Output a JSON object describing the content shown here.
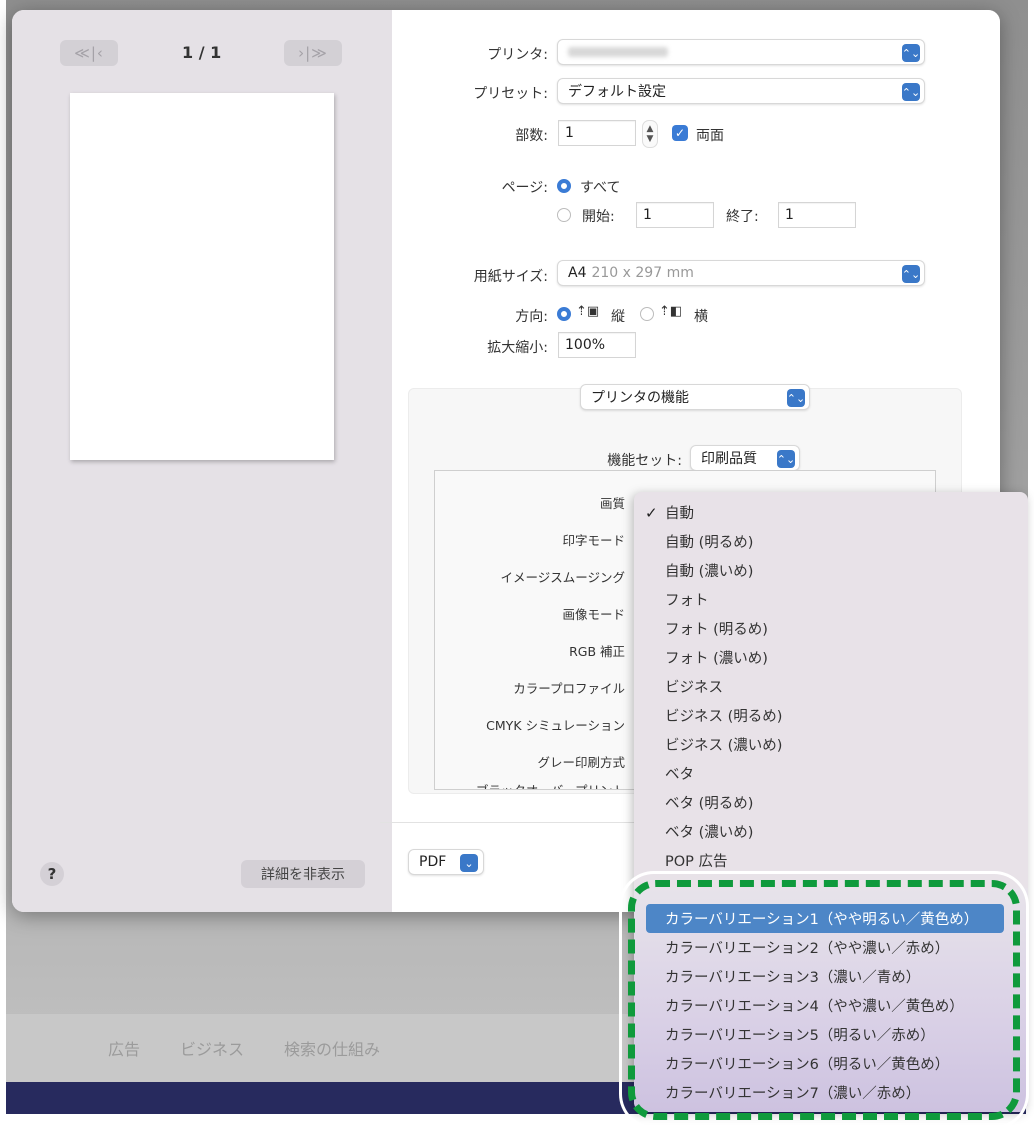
{
  "background_page": {
    "footer_links": [
      "広告",
      "ビジネス",
      "検索の仕組み"
    ],
    "colors": {
      "footer_bar": "#272a5e"
    }
  },
  "print_dialog": {
    "preview": {
      "first_prev_label": "≪|‹",
      "next_last_label": "›|≫",
      "page_indicator": "1 / 1"
    },
    "help_button_label": "?",
    "hide_details_label": "詳細を非表示",
    "printer": {
      "label": "プリンタ:",
      "value": "(blurred)"
    },
    "preset": {
      "label": "プリセット:",
      "value": "デフォルト設定"
    },
    "copies": {
      "label": "部数:",
      "value": "1",
      "duplex_label": "両面",
      "duplex_checked": true
    },
    "pages": {
      "label": "ページ:",
      "all_label": "すべて",
      "all_selected": true,
      "from_label": "開始:",
      "from_value": "1",
      "to_label": "終了:",
      "to_value": "1"
    },
    "paper_size": {
      "label": "用紙サイズ:",
      "value_main": "A4",
      "value_detail": "210 x 297 mm"
    },
    "orientation": {
      "label": "方向:",
      "portrait_label": "縦",
      "landscape_label": "横",
      "selected": "portrait"
    },
    "scale": {
      "label": "拡大縮小:",
      "value": "100%"
    },
    "section_popup": {
      "value": "プリンタの機能"
    },
    "feature_set": {
      "label": "機能セット:",
      "value": "印刷品質"
    },
    "feature_labels": [
      "画質",
      "印字モード",
      "イメージスムージング",
      "画像モード",
      "RGB 補正",
      "カラープロファイル",
      "CMYK シミュレーション",
      "グレー印刷方式",
      "ブラックオーバープリント"
    ],
    "pdf_button_label": "PDF",
    "colors": {
      "accent": "#3a7bd5",
      "highlight": "#4d86c7",
      "annotation_dash": "#0f9a3c"
    }
  },
  "quality_menu": {
    "selected_index": 0,
    "highlighted_index": 14,
    "check_glyph": "✓",
    "items": [
      "自動",
      "自動 (明るめ)",
      "自動 (濃いめ)",
      "フォト",
      "フォト (明るめ)",
      "フォト (濃いめ)",
      "ビジネス",
      "ビジネス (明るめ)",
      "ビジネス (濃いめ)",
      "ベタ",
      "ベタ (明るめ)",
      "ベタ (濃いめ)",
      "POP 広告",
      "",
      "カラーバリエーション1（やや明るい／黄色め）",
      "カラーバリエーション2（やや濃い／赤め）",
      "カラーバリエーション3（濃い／青め）",
      "カラーバリエーション4（やや濃い／黄色め）",
      "カラーバリエーション5（明るい／赤め）",
      "カラーバリエーション6（明るい／黄色め）",
      "カラーバリエーション7（濃い／赤め）"
    ]
  }
}
